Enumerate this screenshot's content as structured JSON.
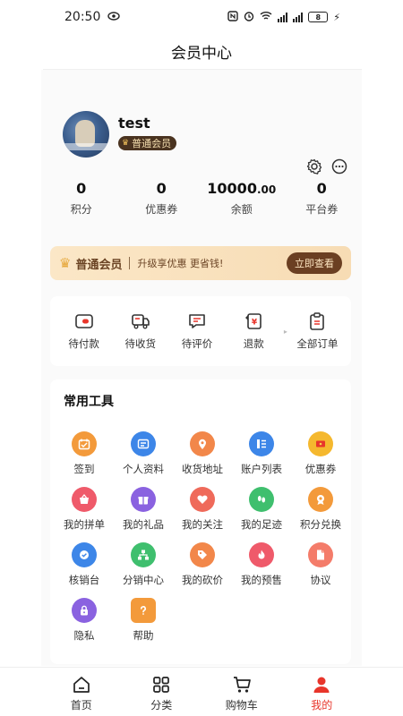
{
  "status_bar": {
    "time": "20:50",
    "battery": "8"
  },
  "header": {
    "title": "会员中心"
  },
  "profile": {
    "username": "test",
    "badge": "普通会员",
    "stats": [
      {
        "value": "0",
        "label": "积分"
      },
      {
        "value": "0",
        "label": "优惠券"
      },
      {
        "value_int": "10000",
        "value_dec": ".00",
        "label": "余额"
      },
      {
        "value": "0",
        "label": "平台券"
      }
    ]
  },
  "banner": {
    "title": "普通会员",
    "text": "升级享优惠 更省钱!",
    "button": "立即查看"
  },
  "orders": [
    {
      "label": "待付款",
      "icon": "wallet-icon"
    },
    {
      "label": "待收货",
      "icon": "truck-icon"
    },
    {
      "label": "待评价",
      "icon": "comment-icon"
    },
    {
      "label": "退款",
      "icon": "refund-icon"
    },
    {
      "label": "全部订单",
      "icon": "clipboard-icon"
    }
  ],
  "tools": {
    "title": "常用工具",
    "items": [
      {
        "label": "签到",
        "icon": "calendar-icon",
        "color": "#f39a3b"
      },
      {
        "label": "个人资料",
        "icon": "id-card-icon",
        "color": "#3d86e8"
      },
      {
        "label": "收货地址",
        "icon": "location-icon",
        "color": "#f2874a"
      },
      {
        "label": "账户列表",
        "icon": "list-icon",
        "color": "#3d86e8"
      },
      {
        "label": "优惠券",
        "icon": "coupon-icon",
        "color": "#f5b82e"
      },
      {
        "label": "我的拼单",
        "icon": "basket-icon",
        "color": "#ef5a6a"
      },
      {
        "label": "我的礼品",
        "icon": "gift-icon",
        "color": "#8a62e0"
      },
      {
        "label": "我的关注",
        "icon": "heart-icon",
        "color": "#ef6a5a"
      },
      {
        "label": "我的足迹",
        "icon": "footprint-icon",
        "color": "#3fbf6e"
      },
      {
        "label": "积分兑换",
        "icon": "medal-icon",
        "color": "#f39a3b"
      },
      {
        "label": "核销台",
        "icon": "verify-icon",
        "color": "#3d86e8"
      },
      {
        "label": "分销中心",
        "icon": "network-icon",
        "color": "#3fbf6e"
      },
      {
        "label": "我的砍价",
        "icon": "tag-icon",
        "color": "#f2874a"
      },
      {
        "label": "我的预售",
        "icon": "flame-icon",
        "color": "#ef5a6a"
      },
      {
        "label": "协议",
        "icon": "document-icon",
        "color": "#f47c6a"
      },
      {
        "label": "隐私",
        "icon": "lock-icon",
        "color": "#8a62e0"
      },
      {
        "label": "帮助",
        "icon": "help-icon",
        "color": "#f39a3b"
      }
    ]
  },
  "tabbar": [
    {
      "label": "首页",
      "icon": "home-icon"
    },
    {
      "label": "分类",
      "icon": "category-icon"
    },
    {
      "label": "购物车",
      "icon": "cart-icon"
    },
    {
      "label": "我的",
      "icon": "user-icon"
    }
  ],
  "colors": {
    "active_tab": "#e8352b",
    "banner_button": "#6b3f22"
  }
}
